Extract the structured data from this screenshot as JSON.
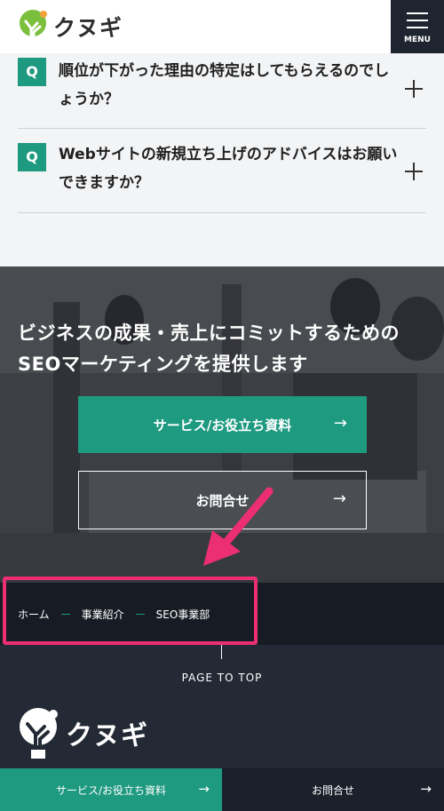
{
  "header": {
    "logo_text": "クヌギ",
    "menu_label": "MENU"
  },
  "faq": {
    "items": [
      {
        "badge": "Q",
        "question": "順位が下がった理由の特定はしてもらえるのでしょうか？"
      },
      {
        "badge": "Q",
        "question": "Webサイトの新規立ち上げのアドバイスはお願いできますか？"
      }
    ]
  },
  "hero": {
    "title": "ビジネスの成果・売上にコミットするためのSEOマーケティングを提供します",
    "service_button": "サービス/お役立ち資料",
    "contact_button": "お問合せ",
    "arrow": "→"
  },
  "breadcrumb": {
    "items": [
      "ホーム",
      "事業紹介",
      "SEO事業部"
    ]
  },
  "footer": {
    "page_to_top": "PAGE TO TOP",
    "logo_text": "クヌギ",
    "service_button": "サービス/お役立ち資料",
    "contact_button": "お問合せ",
    "arrow": "→"
  },
  "colors": {
    "brand_green": "#1e9a80",
    "dark_navy": "#232a35",
    "highlight_pink": "#ec2f72",
    "logo_orange": "#f2a33a",
    "logo_green": "#7cbf3d"
  }
}
